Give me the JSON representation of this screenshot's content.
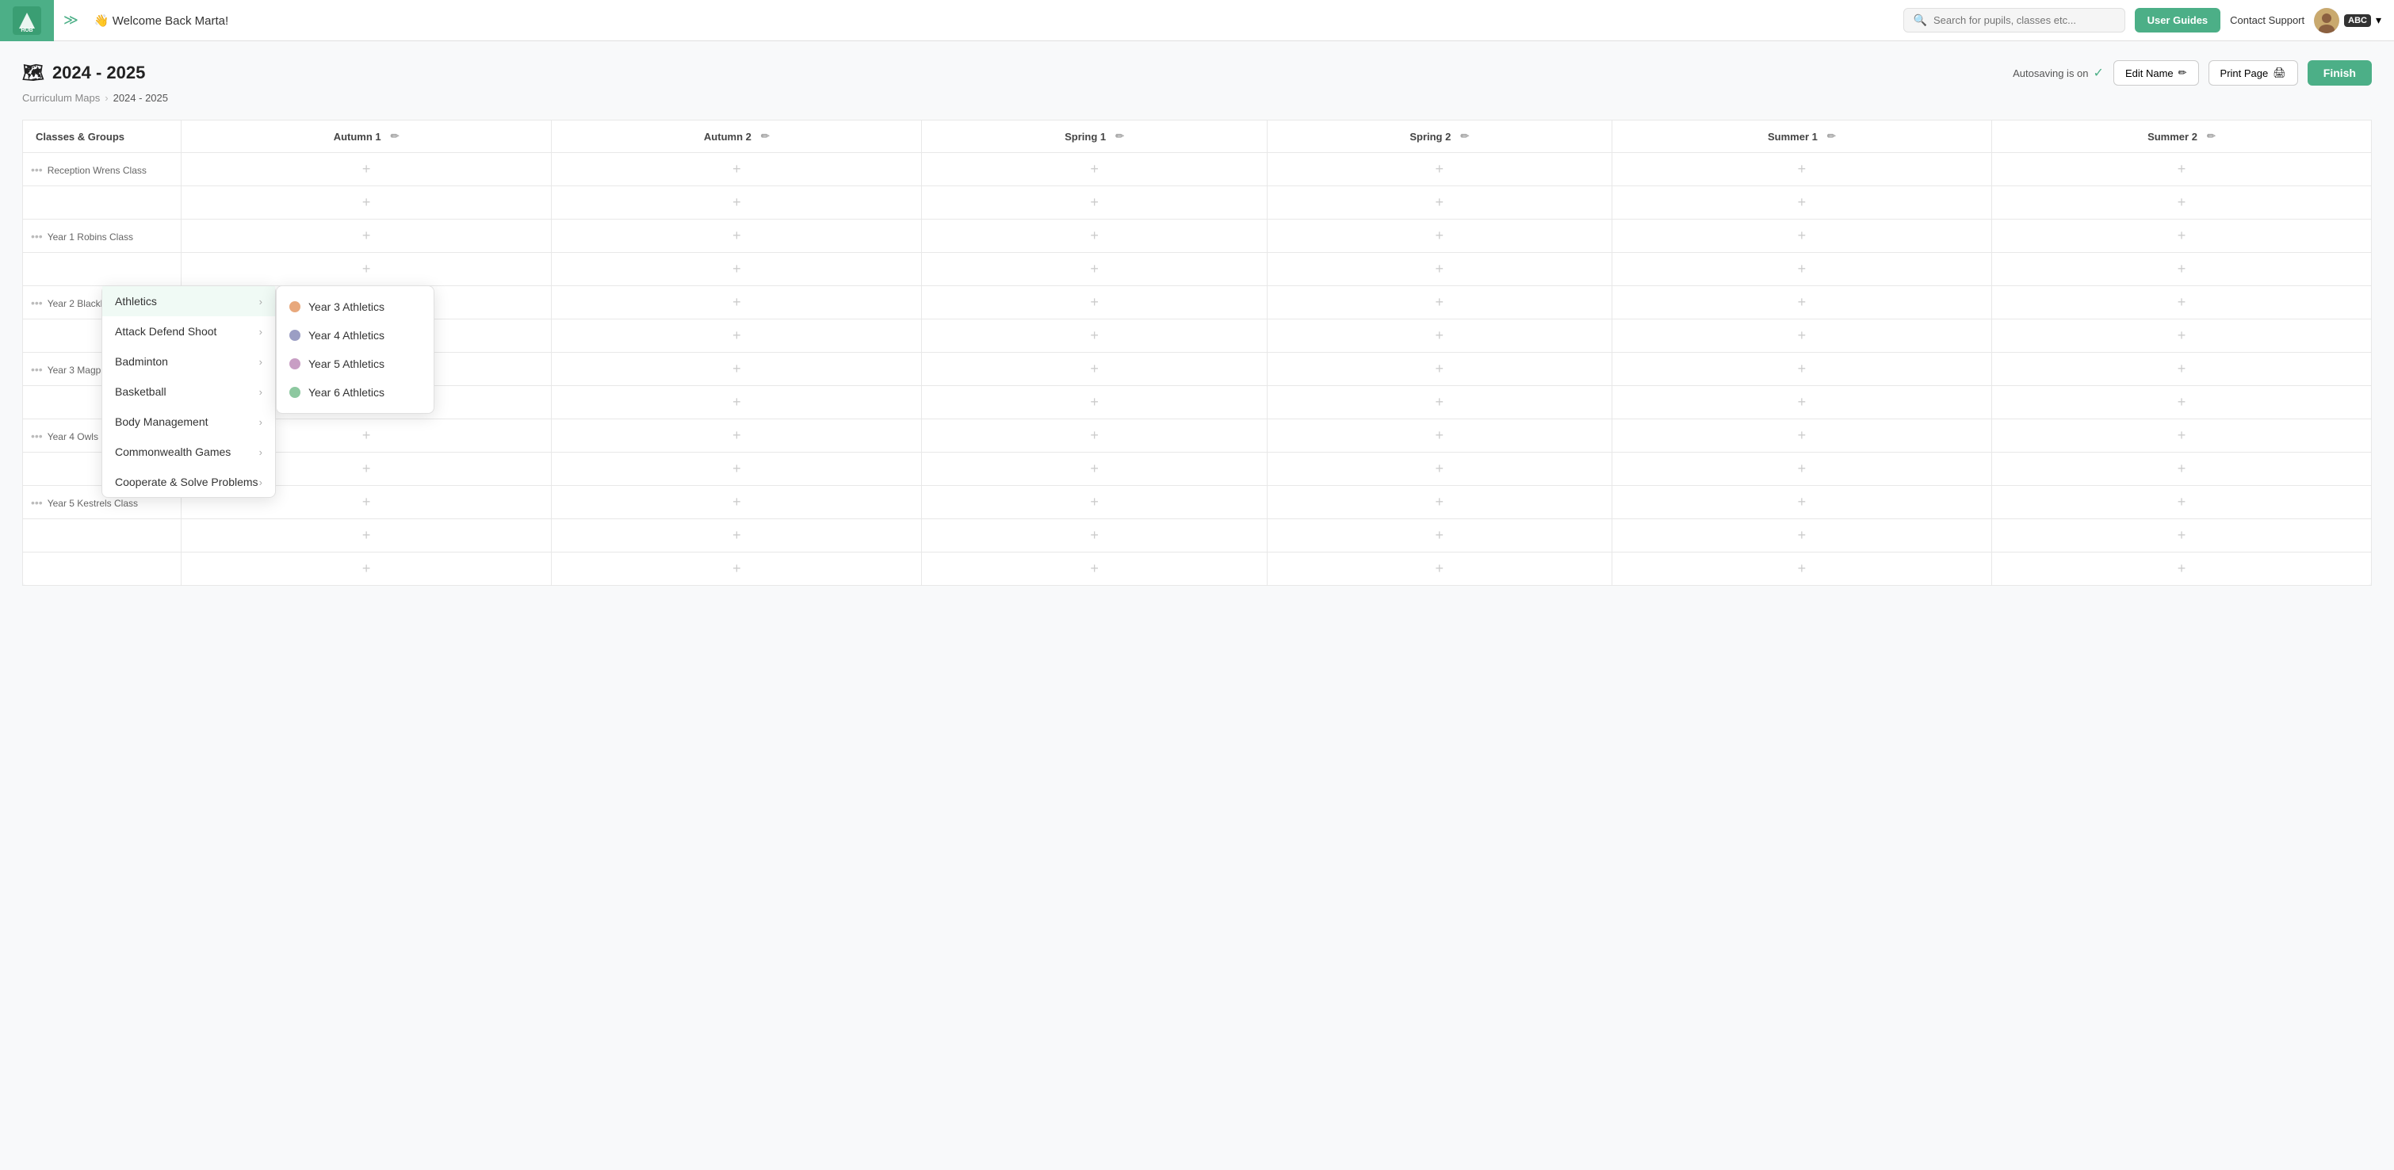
{
  "header": {
    "welcome": "👋 Welcome Back Marta!",
    "search_placeholder": "Search for pupils, classes etc...",
    "user_guides_label": "User Guides",
    "contact_support_label": "Contact Support",
    "abc_badge": "ABC",
    "chevron": "▾"
  },
  "page": {
    "title": "2024 - 2025",
    "title_icon": "🗺",
    "autosave_label": "Autosaving is on",
    "edit_name_label": "Edit Name",
    "print_page_label": "Print Page",
    "finish_label": "Finish",
    "breadcrumb_root": "Curriculum Maps",
    "breadcrumb_current": "2024 - 2025"
  },
  "table": {
    "columns": [
      {
        "label": "Classes & Groups",
        "editable": false
      },
      {
        "label": "Autumn 1",
        "editable": true
      },
      {
        "label": "Autumn 2",
        "editable": true
      },
      {
        "label": "Spring 1",
        "editable": true
      },
      {
        "label": "Spring 2",
        "editable": true
      },
      {
        "label": "Summer 1",
        "editable": true
      },
      {
        "label": "Summer 2",
        "editable": true
      }
    ],
    "rows": [
      {
        "label": "Reception Wrens Class",
        "id": "reception-wrens"
      },
      {
        "label": "",
        "id": "reception-wrens-2"
      },
      {
        "label": "Year 1 Robins Class",
        "id": "year1-robins"
      },
      {
        "label": "",
        "id": "year1-robins-2"
      },
      {
        "label": "Year 2 Blackbirds",
        "id": "year2-blackbirds"
      },
      {
        "label": "",
        "id": "year2-blackbirds-2"
      },
      {
        "label": "Year 3 Magpies",
        "id": "year3-magpies"
      },
      {
        "label": "",
        "id": "year3-magpies-2"
      },
      {
        "label": "Year 4 Owls",
        "id": "year4-owls"
      },
      {
        "label": "",
        "id": "year4-owls-2"
      },
      {
        "label": "Year 5 Kestrels Class",
        "id": "year5-kestrels"
      },
      {
        "label": "",
        "id": "year5-kestrels-2"
      },
      {
        "label": "",
        "id": "extra-row"
      }
    ]
  },
  "dropdown": {
    "items": [
      {
        "label": "Athletics",
        "active": true
      },
      {
        "label": "Attack Defend Shoot",
        "active": false
      },
      {
        "label": "Badminton",
        "active": false
      },
      {
        "label": "Basketball",
        "active": false
      },
      {
        "label": "Body Management",
        "active": false
      },
      {
        "label": "Commonwealth Games",
        "active": false
      },
      {
        "label": "Cooperate & Solve Problems",
        "active": false
      }
    ]
  },
  "submenu": {
    "items": [
      {
        "label": "Year 3 Athletics",
        "color": "#E8A87C"
      },
      {
        "label": "Year 4 Athletics",
        "color": "#9B9EC4"
      },
      {
        "label": "Year 5 Athletics",
        "color": "#C89EC4"
      },
      {
        "label": "Year 6 Athletics",
        "color": "#8DC8A0"
      }
    ]
  }
}
